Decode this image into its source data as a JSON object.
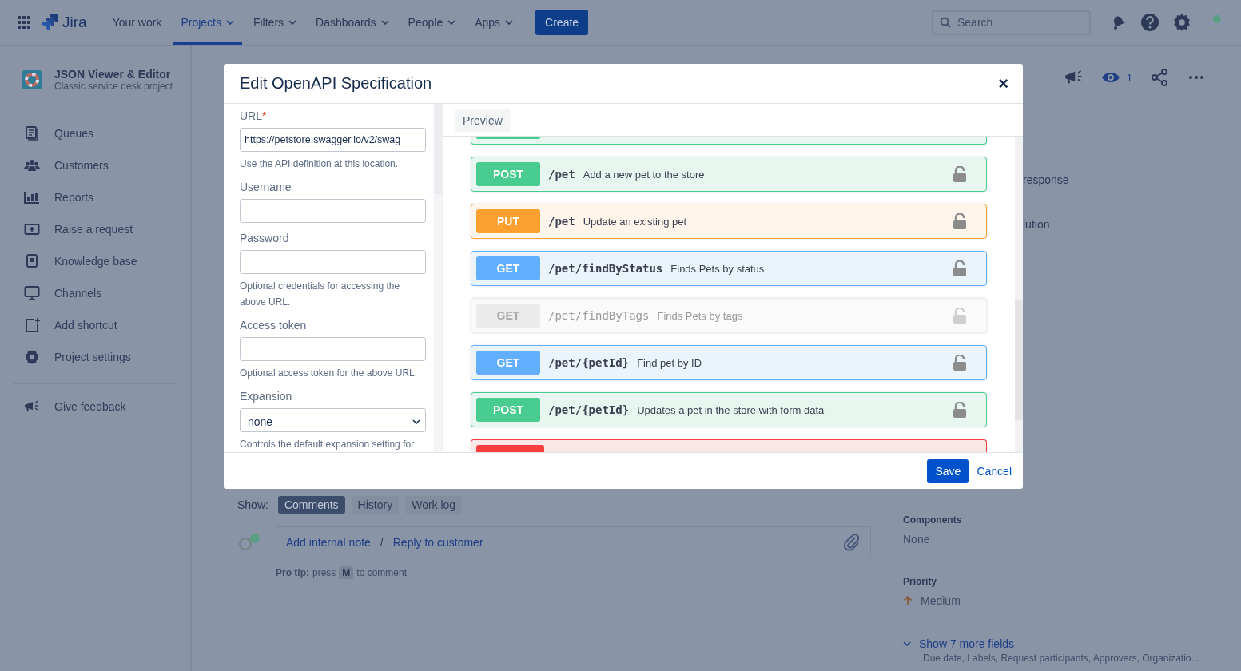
{
  "topnav": {
    "product": "Jira",
    "items": [
      {
        "label": "Your work",
        "dropdown": false,
        "selected": false
      },
      {
        "label": "Projects",
        "dropdown": true,
        "selected": true
      },
      {
        "label": "Filters",
        "dropdown": true,
        "selected": false
      },
      {
        "label": "Dashboards",
        "dropdown": true,
        "selected": false
      },
      {
        "label": "People",
        "dropdown": true,
        "selected": false
      },
      {
        "label": "Apps",
        "dropdown": true,
        "selected": false
      }
    ],
    "create": "Create",
    "search": {
      "placeholder": "Search"
    }
  },
  "sidebar": {
    "project_name": "JSON Viewer & Editor",
    "project_type": "Classic service desk project",
    "items": [
      {
        "label": "Queues"
      },
      {
        "label": "Customers"
      },
      {
        "label": "Reports"
      },
      {
        "label": "Raise a request"
      },
      {
        "label": "Knowledge base"
      },
      {
        "label": "Channels"
      },
      {
        "label": "Add shortcut"
      },
      {
        "label": "Project settings"
      }
    ],
    "feedback": "Give feedback"
  },
  "issue_actions": {
    "watchers": "1"
  },
  "background_fields": [
    "response",
    "lution"
  ],
  "activity": {
    "show_label": "Show:",
    "tabs": [
      {
        "label": "Comments",
        "selected": true
      },
      {
        "label": "History",
        "selected": false
      },
      {
        "label": "Work log",
        "selected": false
      }
    ],
    "comment_actions": [
      "Add internal note",
      "Reply to customer"
    ],
    "separator": "/",
    "tip": {
      "lead": "Pro tip:",
      "before": "press",
      "key": "M",
      "after": "to comment"
    }
  },
  "details": {
    "fields": [
      {
        "label": "Components",
        "value": "None",
        "kind": "plain"
      },
      {
        "label": "Priority",
        "value": "Medium",
        "kind": "priority"
      }
    ],
    "more": "Show 7 more fields",
    "more_hint": "Due date, Labels, Request participants, Approvers, Organizatio..."
  },
  "dialog": {
    "title": "Edit OpenAPI Specification",
    "close": "×",
    "form": [
      {
        "label": "URL",
        "required_mark": "*",
        "kind": "text",
        "value": "https://petstore.swagger.io/v2/swag",
        "help": "Use the API definition at this location."
      },
      {
        "label": "Username",
        "kind": "text"
      },
      {
        "label": "Password",
        "kind": "password",
        "help": "Optional credentials for accessing the above URL."
      },
      {
        "label": "Access token",
        "kind": "text",
        "help": "Optional access token for the above URL."
      },
      {
        "label": "Expansion",
        "kind": "select",
        "value": "none",
        "help": "Controls the default expansion setting for"
      }
    ],
    "preview_tab": "Preview",
    "operations": [
      {
        "kind": "post"
      },
      {
        "kind": "post",
        "method": "POST",
        "path": "/pet",
        "summary": "Add a new pet to the store",
        "deprecated": false
      },
      {
        "kind": "put",
        "method": "PUT",
        "path": "/pet",
        "summary": "Update an existing pet",
        "deprecated": false
      },
      {
        "kind": "get",
        "method": "GET",
        "path": "/pet/findByStatus",
        "summary": "Finds Pets by status",
        "deprecated": false
      },
      {
        "kind": "get",
        "method": "GET",
        "path": "/pet/findByTags",
        "summary": "Finds Pets by tags",
        "deprecated": true
      },
      {
        "kind": "get",
        "method": "GET",
        "path": "/pet/{petId}",
        "summary": "Find pet by ID",
        "deprecated": false
      },
      {
        "kind": "post",
        "method": "POST",
        "path": "/pet/{petId}",
        "summary": "Updates a pet in the store with form data",
        "deprecated": false
      },
      {
        "kind": "delete"
      }
    ],
    "save": "Save",
    "cancel": "Cancel"
  }
}
